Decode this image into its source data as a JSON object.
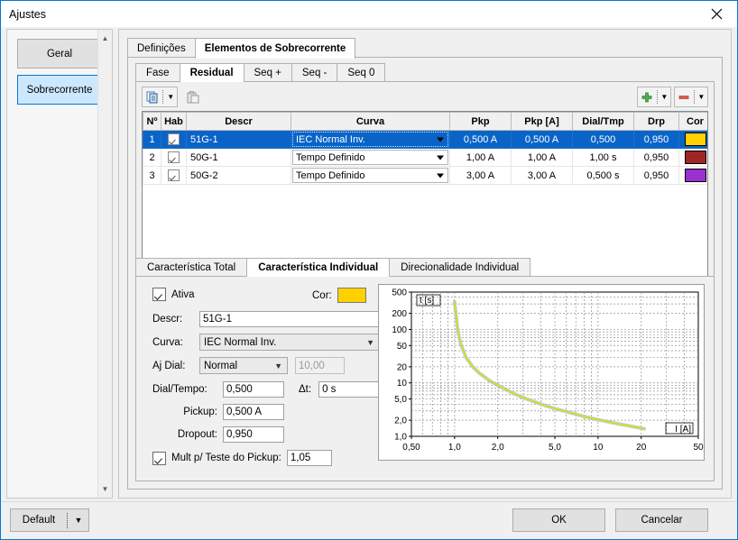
{
  "window": {
    "title": "Ajustes",
    "close_icon": "close-icon"
  },
  "sidebar": {
    "items": [
      {
        "label": "Geral",
        "selected": false
      },
      {
        "label": "Sobrecorrente",
        "selected": true
      }
    ],
    "scroll_up_icon": "chevron-up-icon",
    "scroll_down_icon": "chevron-down-icon"
  },
  "outer_tabs": [
    {
      "label": "Definições",
      "active": false
    },
    {
      "label": "Elementos de Sobrecorrente",
      "active": true
    }
  ],
  "inner_tabs": [
    {
      "label": "Fase",
      "active": false
    },
    {
      "label": "Residual",
      "active": true
    },
    {
      "label": "Seq +",
      "active": false
    },
    {
      "label": "Seq -",
      "active": false
    },
    {
      "label": "Seq 0",
      "active": false
    }
  ],
  "toolbar": {
    "copy_icon": "copy-icon",
    "copy_dropdown_icon": "chevron-down-icon",
    "paste_icon": "paste-icon",
    "add_icon": "plus-icon",
    "add_dropdown_icon": "chevron-down-icon",
    "remove_icon": "minus-icon",
    "remove_dropdown_icon": "chevron-down-icon"
  },
  "table": {
    "headers": [
      "Nº",
      "Hab",
      "Descr",
      "Curva",
      "Pkp",
      "Pkp [A]",
      "Dial/Tmp",
      "Drp",
      "Cor"
    ],
    "rows": [
      {
        "num": "1",
        "hab": true,
        "descr": "51G-1",
        "curva": "IEC Normal Inv.",
        "pkp": "0,500 A",
        "pkp_a": "0,500 A",
        "dial_tmp": "0,500",
        "drp": "0,950",
        "cor": "#FFD100",
        "selected": true
      },
      {
        "num": "2",
        "hab": true,
        "descr": "50G-1",
        "curva": "Tempo Definido",
        "pkp": "1,00 A",
        "pkp_a": "1,00 A",
        "dial_tmp": "1,00 s",
        "drp": "0,950",
        "cor": "#A02525",
        "selected": false
      },
      {
        "num": "3",
        "hab": true,
        "descr": "50G-2",
        "curva": "Tempo Definido",
        "pkp": "3,00 A",
        "pkp_a": "3,00 A",
        "dial_tmp": "0,500 s",
        "drp": "0,950",
        "cor": "#9B30D0",
        "selected": false
      }
    ]
  },
  "lower_tabs": [
    {
      "label": "Característica Total",
      "active": false
    },
    {
      "label": "Característica Individual",
      "active": true
    },
    {
      "label": "Direcionalidade Individual",
      "active": false
    }
  ],
  "form": {
    "ativa_label": "Ativa",
    "ativa_checked": true,
    "cor_label": "Cor:",
    "cor_value": "#FFD100",
    "descr_label": "Descr:",
    "descr_value": "51G-1",
    "curva_label": "Curva:",
    "curva_value": "IEC Normal Inv.",
    "curva_chevron_icon": "chevron-down-icon",
    "ajdial_label": "Aj Dial:",
    "ajdial_value": "Normal",
    "ajdial_chevron_icon": "chevron-down-icon",
    "ajdial_extra_value": "10,00",
    "dial_tempo_label": "Dial/Tempo:",
    "dial_tempo_value": "0,500",
    "delta_t_label": "Δt:",
    "delta_t_value": "0 s",
    "pickup_label": "Pickup:",
    "pickup_value": "0,500 A",
    "dropout_label": "Dropout:",
    "dropout_value": "0,950",
    "mult_label": "Mult p/ Teste do Pickup:",
    "mult_checked": true,
    "mult_value": "1,05"
  },
  "footer": {
    "default_label": "Default",
    "default_dropdown_icon": "chevron-down-icon",
    "ok_label": "OK",
    "cancel_label": "Cancelar"
  },
  "chart_data": {
    "type": "line",
    "title": "",
    "xlabel": "I [A]",
    "ylabel": "t [s]",
    "xscale": "log",
    "yscale": "log",
    "xlim": [
      0.5,
      50
    ],
    "ylim": [
      1.0,
      500
    ],
    "xticks": [
      0.5,
      1.0,
      2.0,
      5.0,
      10,
      20,
      50
    ],
    "xticklabels": [
      "0,50",
      "1,0",
      "2,0",
      "5,0",
      "10",
      "20",
      "50"
    ],
    "yticks": [
      1.0,
      2.0,
      5.0,
      10,
      20,
      50,
      100,
      200,
      500
    ],
    "yticklabels": [
      "1,0",
      "2,0",
      "5,0",
      "10",
      "20",
      "50",
      "100",
      "200",
      "500"
    ],
    "grid": true,
    "legend": "none",
    "series": [
      {
        "name": "51G-1 IEC Normal Inv. (halo)",
        "color": "#8FCBE8",
        "width": 4,
        "x": [
          1.0,
          1.02,
          1.05,
          1.1,
          1.2,
          1.35,
          1.5,
          1.75,
          2.0,
          2.5,
          3.0,
          4.0,
          5.0,
          6.0,
          8.0,
          10.0,
          14.0,
          20.0,
          21.0
        ],
        "y": [
          330,
          200,
          100,
          55,
          30,
          19.5,
          15.0,
          11.0,
          9.0,
          6.6,
          5.3,
          4.0,
          3.3,
          2.9,
          2.35,
          2.05,
          1.7,
          1.42,
          1.38
        ]
      },
      {
        "name": "51G-1 IEC Normal Inv.",
        "color": "#E8D420",
        "width": 2,
        "x": [
          1.0,
          1.02,
          1.05,
          1.1,
          1.2,
          1.35,
          1.5,
          1.75,
          2.0,
          2.5,
          3.0,
          4.0,
          5.0,
          6.0,
          8.0,
          10.0,
          14.0,
          20.0,
          21.0
        ],
        "y": [
          330,
          200,
          100,
          55,
          30,
          19.5,
          15.0,
          11.0,
          9.0,
          6.6,
          5.3,
          4.0,
          3.3,
          2.9,
          2.35,
          2.05,
          1.7,
          1.42,
          1.38
        ]
      }
    ]
  }
}
